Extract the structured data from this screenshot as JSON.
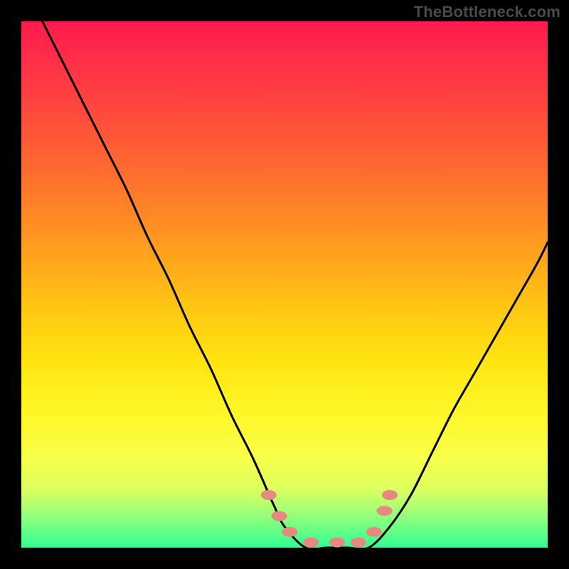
{
  "watermark": "TheBottleneck.com",
  "chart_data": {
    "type": "line",
    "title": "",
    "xlabel": "",
    "ylabel": "",
    "xlim": [
      0,
      100
    ],
    "ylim": [
      0,
      100
    ],
    "gradient_stops": [
      {
        "pos": 0,
        "color": "#ff1a4d"
      },
      {
        "pos": 14,
        "color": "#ff4040"
      },
      {
        "pos": 42,
        "color": "#ff9a20"
      },
      {
        "pos": 65,
        "color": "#ffe610"
      },
      {
        "pos": 89,
        "color": "#dcff60"
      },
      {
        "pos": 100,
        "color": "#2fff93"
      }
    ],
    "series": [
      {
        "name": "bottleneck-curve",
        "x": [
          4,
          8,
          12,
          16,
          20,
          24,
          28,
          32,
          36,
          40,
          44,
          48,
          50,
          54,
          58,
          62,
          66,
          70,
          74,
          78,
          82,
          86,
          90,
          94,
          98,
          100
        ],
        "y": [
          100,
          92,
          84,
          76,
          68,
          59,
          51,
          42,
          34,
          25,
          17,
          8,
          4,
          0,
          0,
          0,
          0,
          4,
          10,
          18,
          26,
          33,
          40,
          47,
          54,
          58
        ]
      }
    ],
    "markers": {
      "name": "highlight-points",
      "color": "#e58a80",
      "points": [
        {
          "x": 47,
          "y": 10
        },
        {
          "x": 49,
          "y": 6
        },
        {
          "x": 51,
          "y": 3
        },
        {
          "x": 55,
          "y": 1
        },
        {
          "x": 60,
          "y": 1
        },
        {
          "x": 64,
          "y": 1
        },
        {
          "x": 67,
          "y": 3
        },
        {
          "x": 69,
          "y": 7
        },
        {
          "x": 70,
          "y": 10
        }
      ]
    }
  }
}
